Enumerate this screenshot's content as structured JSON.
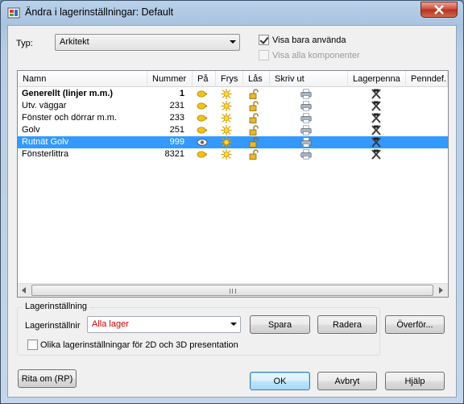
{
  "window": {
    "title": "Ändra i lagerinställningar: Default"
  },
  "type": {
    "label": "Typ:",
    "value": "Arkitekt"
  },
  "options": {
    "show_used": {
      "label": "Visa bara använda",
      "checked": true
    },
    "show_all_components": {
      "label": "Visa alla komponenter",
      "checked": false,
      "disabled": true
    }
  },
  "table": {
    "columns": [
      "Namn",
      "Nummer",
      "På",
      "Frys",
      "Lås",
      "Skriv ut",
      "Lagerpenna",
      "Penndef."
    ],
    "rows": [
      {
        "name": "Generellt (linjer m.m.)",
        "number": "1",
        "bold": true,
        "selected": false,
        "on": "on"
      },
      {
        "name": "Utv. väggar",
        "number": "231",
        "bold": false,
        "selected": false,
        "on": "on"
      },
      {
        "name": "Fönster och dörrar m.m.",
        "number": "233",
        "bold": false,
        "selected": false,
        "on": "on"
      },
      {
        "name": "Golv",
        "number": "251",
        "bold": false,
        "selected": false,
        "on": "on"
      },
      {
        "name": "Rutnät Golv",
        "number": "999",
        "bold": false,
        "selected": true,
        "on": "off"
      },
      {
        "name": "Fönsterlittra",
        "number": "8321",
        "bold": false,
        "selected": false,
        "on": "on"
      }
    ]
  },
  "layer_setting": {
    "group_title": "Lagerinställning",
    "label": "Lagerinställnir",
    "value": "Alla lager",
    "value_color": "#cc0000",
    "save": "Spara",
    "delete": "Radera",
    "transfer": "Överför...",
    "separate_2d_3d": {
      "label": "Olika lagerinställningar för 2D och 3D presentation",
      "checked": false
    }
  },
  "buttons": {
    "redraw": "Rita om (RP)",
    "ok": "OK",
    "cancel": "Avbryt",
    "help": "Hjälp"
  },
  "icons": {
    "on": "lightbulb-icon",
    "off": "eye-icon",
    "freeze": "sun-icon",
    "lock": "padlock-icon",
    "print": "printer-icon",
    "pen": "pen-icon"
  }
}
